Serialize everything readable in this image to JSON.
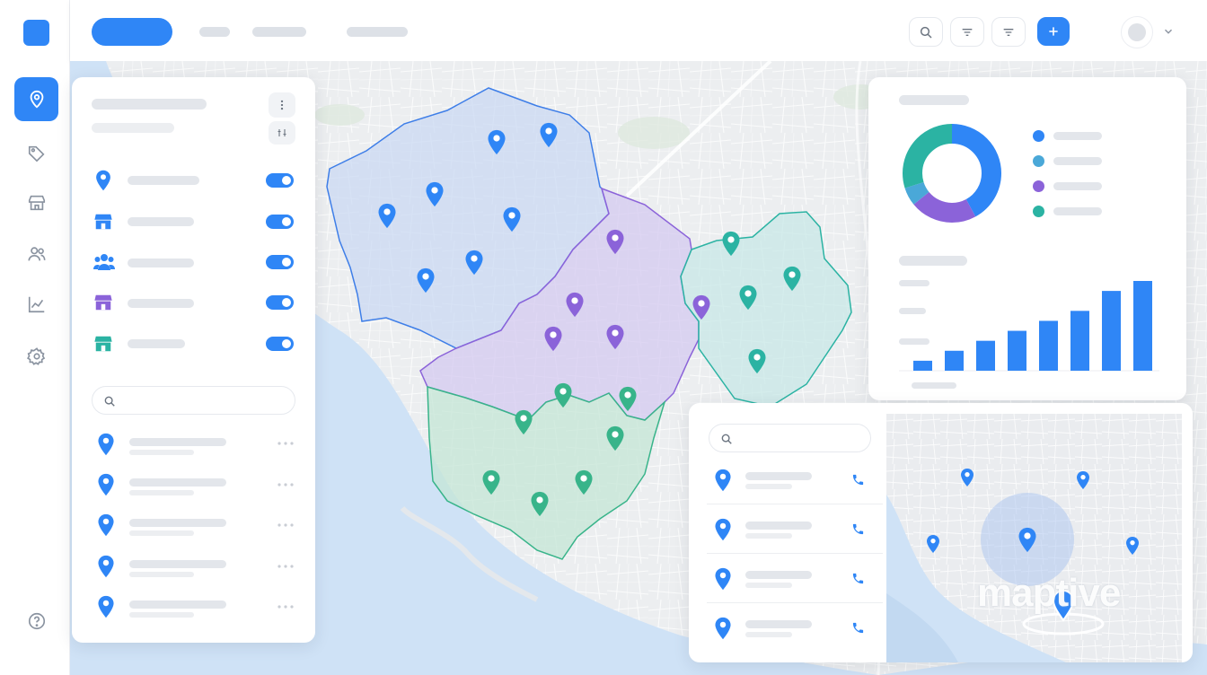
{
  "brand": {
    "accent": "#2f86f6",
    "purple": "#8b63d9",
    "teal": "#2bb3a3",
    "green": "#38b48a"
  },
  "watermark_text": "maptive",
  "search": {
    "layers_placeholder": "",
    "locations_placeholder": ""
  },
  "rail": {
    "items": [
      "location-pin-icon",
      "tag-icon",
      "store-icon",
      "users-icon",
      "chart-icon",
      "gear-icon"
    ],
    "help": "help-icon"
  },
  "donut": {
    "segments": [
      {
        "color": "#2f86f6",
        "fraction": 0.42
      },
      {
        "color": "#8b63d9",
        "fraction": 0.22
      },
      {
        "color": "#4aa8d8",
        "fraction": 0.06
      },
      {
        "color": "#2bb3a3",
        "fraction": 0.3
      }
    ]
  },
  "chart_data": {
    "type": "bar",
    "categories": [
      "",
      "",
      "",
      "",
      "",
      "",
      "",
      ""
    ],
    "values": [
      1,
      2,
      3,
      4,
      5,
      6,
      8,
      9
    ],
    "ylim": [
      0,
      9
    ],
    "legend": "none",
    "grid": false,
    "color": "#2f86f6"
  }
}
